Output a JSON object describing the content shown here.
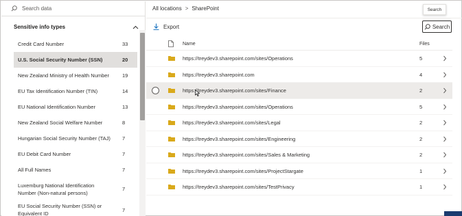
{
  "left_panel": {
    "search_placeholder": "Search data",
    "section_title": "Sensitive info types",
    "items": [
      {
        "label": "Credit Card Number",
        "count": "33"
      },
      {
        "label": "U.S. Social Security Number (SSN)",
        "count": "20"
      },
      {
        "label": "New Zealand Ministry of Health Number",
        "count": "19"
      },
      {
        "label": "EU Tax Identification Number (TIN)",
        "count": "14"
      },
      {
        "label": "EU National Identification Number",
        "count": "13"
      },
      {
        "label": "New Zealand Social Welfare Number",
        "count": "8"
      },
      {
        "label": "Hungarian Social Security Number (TAJ)",
        "count": "7"
      },
      {
        "label": "EU Debit Card Number",
        "count": "7"
      },
      {
        "label": "All Full Names",
        "count": "7"
      },
      {
        "label": "Luxemburg National Identification Number (Non-natural persons)",
        "count": "7"
      },
      {
        "label": "EU Social Security Number (SSN) or Equivalent ID",
        "count": "7"
      }
    ],
    "selected_index": 1
  },
  "breadcrumb": {
    "root": "All locations",
    "separator": ">",
    "current": "SharePoint"
  },
  "tooltip": "Search",
  "toolbar": {
    "export_label": "Export",
    "search_label": "Search"
  },
  "table": {
    "headers": {
      "name": "Name",
      "files": "Files"
    },
    "rows": [
      {
        "url": "https://treydev3.sharepoint.com/sites/Operations",
        "files": "5"
      },
      {
        "url": "https://treydev3.sharepoint.com",
        "files": "4"
      },
      {
        "url": "https://treydev3.sharepoint.com/sites/Finance",
        "files": "2"
      },
      {
        "url": "https://treydev3.sharepoint.com/sites/Operations",
        "files": "5"
      },
      {
        "url": "https://treydev3.sharepoint.com/sites/Legal",
        "files": "2"
      },
      {
        "url": "https://treydev3.sharepoint.com/sites/Engineering",
        "files": "2"
      },
      {
        "url": "https://treydev3.sharepoint.com/sites/Sales & Marketing",
        "files": "2"
      },
      {
        "url": "https://treydev3.sharepoint.com/sites/ProjectStargate",
        "files": "1"
      },
      {
        "url": "https://treydev3.sharepoint.com/sites/TestPrivacy",
        "files": "1"
      }
    ],
    "hover_index": 2
  },
  "colors": {
    "folder": "#d9a91b",
    "selected_bg": "#e1dfdd",
    "hover_bg": "#edebe9",
    "corner_accent": "#1b3b6f"
  },
  "icons": [
    "search-icon",
    "chevron-up-icon",
    "download-icon",
    "document-icon",
    "folder-icon",
    "chevron-right-icon",
    "radio-icon",
    "mouse-cursor-icon"
  ]
}
